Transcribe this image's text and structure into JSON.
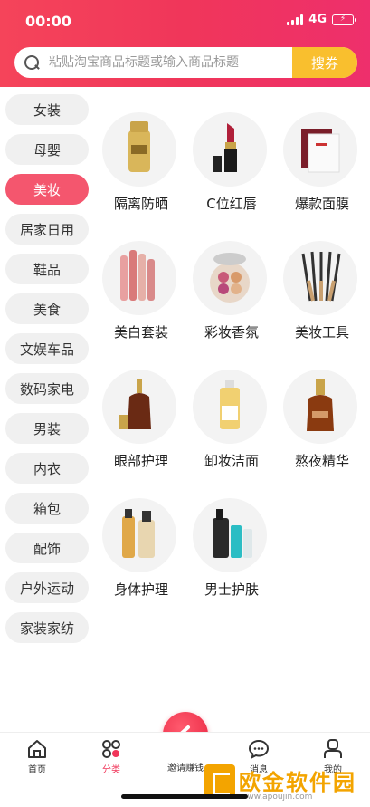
{
  "status_bar": {
    "time": "00:00",
    "network": "4G"
  },
  "search": {
    "placeholder": "粘贴淘宝商品标题或输入商品标题",
    "button_label": "搜券"
  },
  "sidebar": {
    "items": [
      {
        "label": "女装",
        "active": false
      },
      {
        "label": "母婴",
        "active": false
      },
      {
        "label": "美妆",
        "active": true
      },
      {
        "label": "居家日用",
        "active": false
      },
      {
        "label": "鞋品",
        "active": false
      },
      {
        "label": "美食",
        "active": false
      },
      {
        "label": "文娱车品",
        "active": false
      },
      {
        "label": "数码家电",
        "active": false
      },
      {
        "label": "男装",
        "active": false
      },
      {
        "label": "内衣",
        "active": false
      },
      {
        "label": "箱包",
        "active": false
      },
      {
        "label": "配饰",
        "active": false
      },
      {
        "label": "户外运动",
        "active": false
      },
      {
        "label": "家装家纺",
        "active": false
      }
    ]
  },
  "products": [
    {
      "label": "隔离防晒",
      "icon": "sunscreen-icon"
    },
    {
      "label": "C位红唇",
      "icon": "lipstick-icon"
    },
    {
      "label": "爆款面膜",
      "icon": "face-mask-icon"
    },
    {
      "label": "美白套装",
      "icon": "whitening-set-icon"
    },
    {
      "label": "彩妆香氛",
      "icon": "makeup-palette-icon"
    },
    {
      "label": "美妆工具",
      "icon": "makeup-brushes-icon"
    },
    {
      "label": "眼部护理",
      "icon": "eye-serum-icon"
    },
    {
      "label": "卸妆洁面",
      "icon": "cleanser-icon"
    },
    {
      "label": "熬夜精华",
      "icon": "night-essence-icon"
    },
    {
      "label": "身体护理",
      "icon": "body-care-icon"
    },
    {
      "label": "男士护肤",
      "icon": "mens-skincare-icon"
    }
  ],
  "tabbar": {
    "home": "首页",
    "category": "分类",
    "invite": "邀请赚钱",
    "messages": "消息",
    "mine": "我的"
  },
  "watermark": {
    "title": "欧金软件园",
    "url": "www.apoujin.com"
  },
  "colors": {
    "brand": "#f0365a",
    "accent_button": "#f9bf2e",
    "active_category": "#f4566e"
  }
}
